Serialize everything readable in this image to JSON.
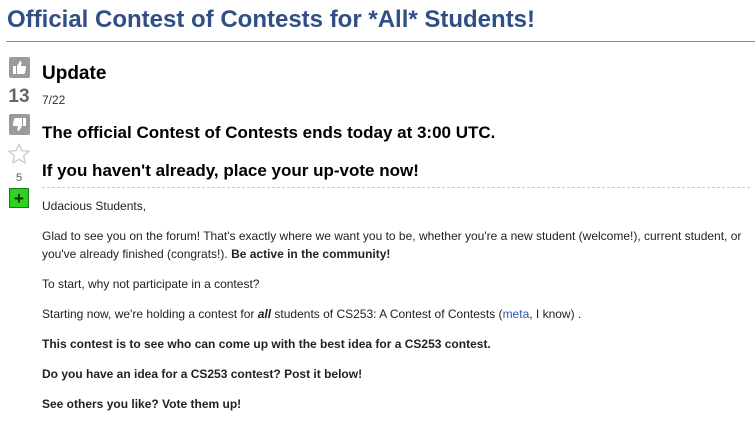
{
  "question": {
    "title": "Official Contest of Contests for *All* Students!"
  },
  "vote": {
    "score": "13",
    "favorite_count": "5",
    "add_symbol": "+"
  },
  "post": {
    "heading": "Update",
    "date": "7/22",
    "ends_line": "The official Contest of Contests ends today at 3:00 UTC.",
    "vote_line": "If you haven't already, place your up-vote now!",
    "greeting": "Udacious Students,",
    "para1_text": "Glad to see you on the forum! That's exactly where we want you to be, whether you're a new student (welcome!), current student, or you've already finished (congrats!). ",
    "para1_bold": "Be active in the community!",
    "para2": "To start, why not participate in a contest?",
    "para3_a": "Starting now, we're holding a contest for ",
    "para3_em": "all",
    "para3_b": " students of CS253: A Contest of Contests (",
    "para3_link": "meta",
    "para3_c": ", I know) .",
    "para4": "This contest is to see who can come up with the best idea for a CS253 contest.",
    "para5": "Do you have an idea for a CS253 contest? Post it below!",
    "para6": "See others you like? Vote them up!"
  },
  "colors": {
    "title": "#2f4f86",
    "vote_button": "#9a9a9a",
    "add_button": "#2ed11d",
    "link": "#2a5db0"
  },
  "icons": {
    "upvote": "thumbs-up-icon",
    "downvote": "thumbs-down-icon",
    "favorite": "star-icon",
    "add": "plus-icon"
  }
}
